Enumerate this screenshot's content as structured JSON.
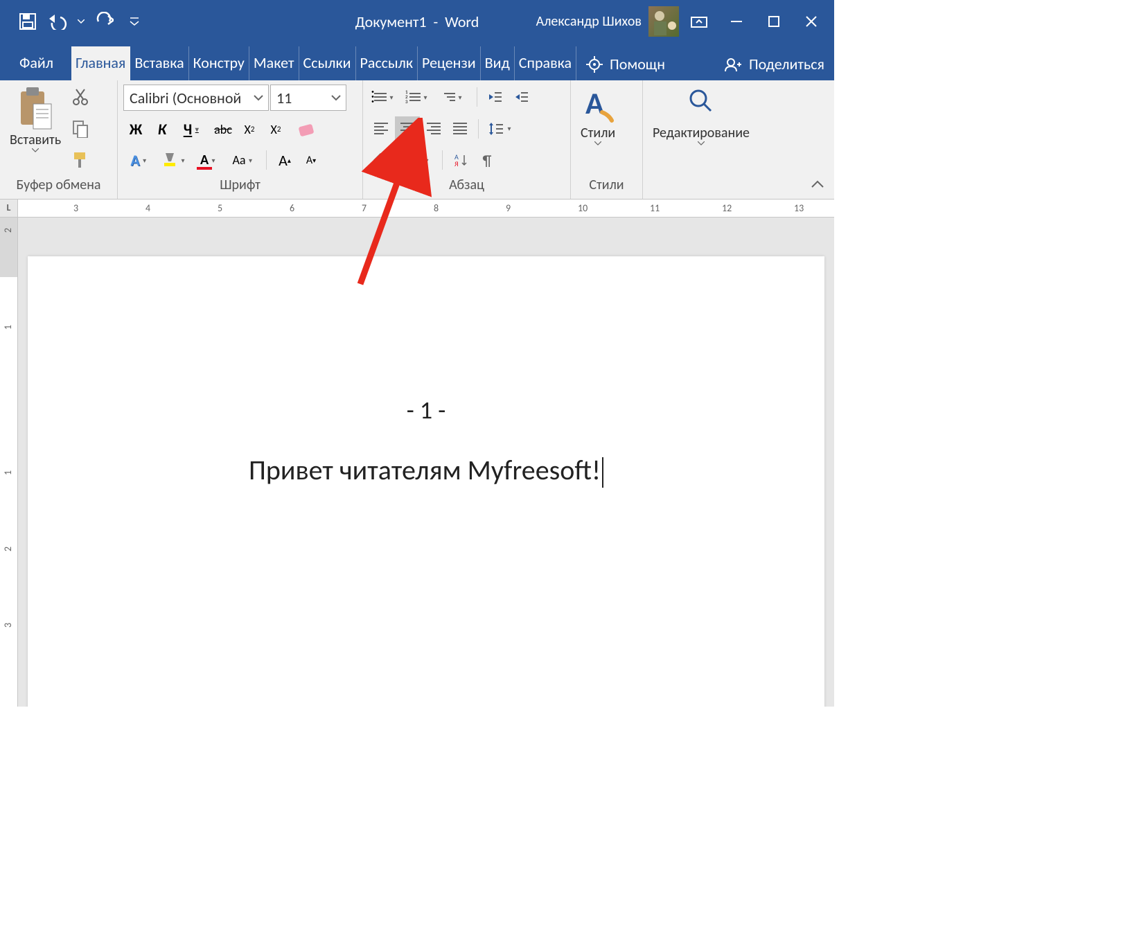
{
  "title": {
    "doc": "Документ1",
    "sep": "-",
    "app": "Word"
  },
  "user": "Александр Шихов",
  "tabs": {
    "file": "Файл",
    "home": "Главная",
    "insert": "Вставка",
    "design": "Констру",
    "layout": "Макет",
    "references": "Ссылки",
    "mailings": "Рассылк",
    "review": "Рецензи",
    "view": "Вид",
    "help": "Справка",
    "tellme": "Помощн",
    "share": "Поделиться"
  },
  "ribbon": {
    "clipboard": {
      "label": "Буфер обмена",
      "paste": "Вставить"
    },
    "font": {
      "label": "Шрифт",
      "name": "Calibri (Основной",
      "size": "11",
      "bold": "Ж",
      "italic": "К",
      "underline": "Ч",
      "strike": "abc"
    },
    "para": {
      "label": "Абзац"
    },
    "styles": {
      "label": "Стили",
      "btn": "Стили"
    },
    "editing": {
      "label": "",
      "btn": "Редактирование"
    }
  },
  "hruler": [
    "3",
    "4",
    "5",
    "6",
    "7",
    "8",
    "9",
    "10",
    "11",
    "12",
    "13"
  ],
  "vruler": [
    "2",
    "1",
    "1",
    "2",
    "3"
  ],
  "document": {
    "pagenum": "- 1 -",
    "text": "Привет читателям Myfreesoft!"
  }
}
